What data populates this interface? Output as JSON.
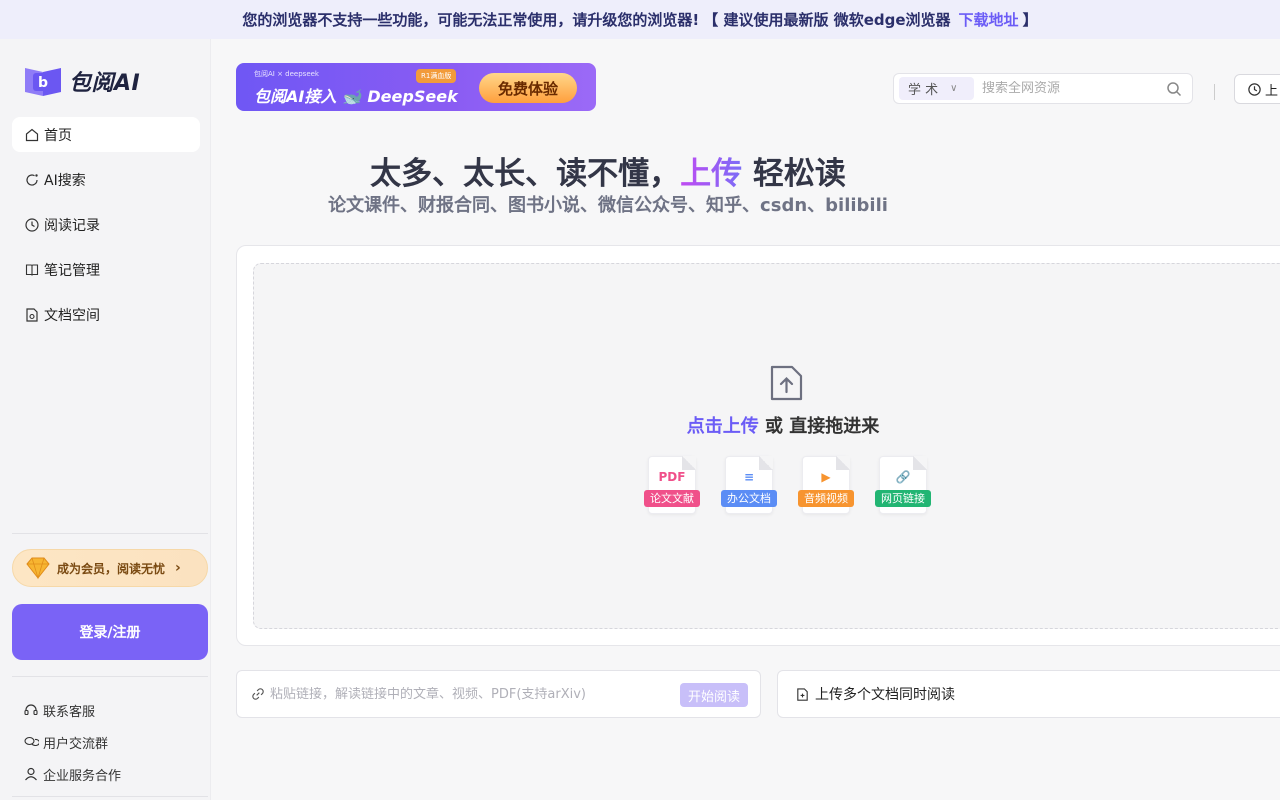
{
  "banner": {
    "message": "您的浏览器不支持一些功能，可能无法正常使用，请升级您的浏览器!",
    "suggest": "【 建议使用最新版 微软edge浏览器",
    "download_link": "下载地址",
    "close_bracket": "】"
  },
  "brand": {
    "name": "包阅AI"
  },
  "sidebar": {
    "items": [
      {
        "label": "首页",
        "icon": "home-icon",
        "active": true
      },
      {
        "label": "AI搜索",
        "icon": "ai-search-icon",
        "active": false
      },
      {
        "label": "阅读记录",
        "icon": "clock-icon",
        "active": false
      },
      {
        "label": "笔记管理",
        "icon": "notebook-icon",
        "active": false
      },
      {
        "label": "文档空间",
        "icon": "document-icon",
        "active": false
      }
    ],
    "vip_label": "成为会员，阅读无忧",
    "login_label": "登录/注册",
    "footer": [
      {
        "label": "联系客服",
        "icon": "headset-icon"
      },
      {
        "label": "用户交流群",
        "icon": "chat-icon"
      },
      {
        "label": "企业服务合作",
        "icon": "user-icon"
      }
    ]
  },
  "promo": {
    "small_text": "包阅AI × deepseek",
    "headline": "包阅AI接入 🐋 DeepSeek",
    "tag": "R1满血版",
    "cta": "免费体验"
  },
  "search": {
    "scope": "学 术",
    "placeholder": "搜索全网资源"
  },
  "history_button": "上",
  "hero": {
    "title_prefix": "太多、太长、读不懂，",
    "title_accent": "上传",
    "title_suffix": " 轻松读",
    "subtitle": "论文课件、财报合同、图书小说、微信公众号、知乎、csdn、bilibili"
  },
  "upload": {
    "highlight": "点击上传",
    "rest": " 或 直接拖进来",
    "types": [
      {
        "glyph": "PDF",
        "label": "论文文献",
        "color": "#f0508a"
      },
      {
        "glyph": "≡",
        "label": "办公文档",
        "color": "#5b8df5"
      },
      {
        "glyph": "▶",
        "label": "音频视频",
        "color": "#f7942f"
      },
      {
        "glyph": "🔗",
        "label": "网页链接",
        "color": "#22b573"
      }
    ]
  },
  "link_input": {
    "placeholder": "粘贴链接，解读链接中的文章、视频、PDF(支持arXiv)",
    "button": "开始阅读"
  },
  "multi_upload": {
    "label": "上传多个文档同时阅读"
  }
}
